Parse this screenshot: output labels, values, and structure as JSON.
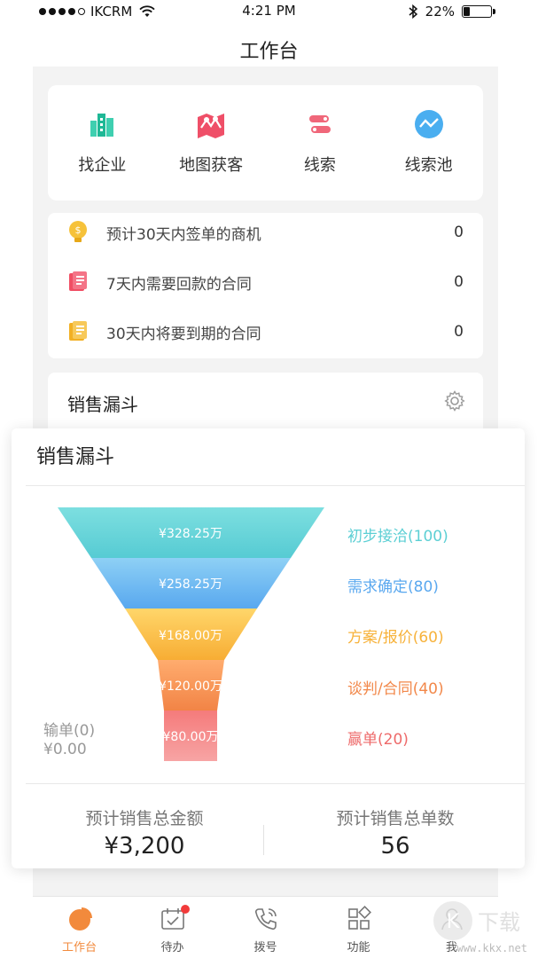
{
  "status_bar": {
    "carrier": "IKCRM",
    "time": "4:21 PM",
    "battery": "22%"
  },
  "header": {
    "title": "工作台"
  },
  "quick_entries": [
    {
      "label": "找企业",
      "icon": "building-icon"
    },
    {
      "label": "地图获客",
      "icon": "map-icon"
    },
    {
      "label": "线索",
      "icon": "route-icon"
    },
    {
      "label": "线索池",
      "icon": "trend-icon"
    }
  ],
  "stats": [
    {
      "label": "预计30天内签单的商机",
      "value": "0",
      "icon": "lightbulb-icon"
    },
    {
      "label": "7天内需要回款的合同",
      "value": "0",
      "icon": "receipt-icon"
    },
    {
      "label": "30天内将要到期的合同",
      "value": "0",
      "icon": "receipt-icon"
    }
  ],
  "funnel_card": {
    "title": "销售漏斗"
  },
  "popup": {
    "title": "销售漏斗",
    "stages": [
      {
        "amount": "¥328.25万",
        "label": "初步接洽(100)",
        "color": "#5ccfd4"
      },
      {
        "amount": "¥258.25万",
        "label": "需求确定(80)",
        "color": "#5aa8ef"
      },
      {
        "amount": "¥168.00万",
        "label": "方案/报价(60)",
        "color": "#f7b23b"
      },
      {
        "amount": "¥120.00万",
        "label": "谈判/合同(40)",
        "color": "#f2884a"
      },
      {
        "amount": "¥80.00万",
        "label": "赢单(20)",
        "color": "#ee6a6a"
      }
    ],
    "lost": {
      "label": "输单(0)",
      "amount": "¥0.00"
    },
    "summary": [
      {
        "label": "预计销售总金额",
        "value": "¥3,200"
      },
      {
        "label": "预计销售总单数",
        "value": "56"
      }
    ]
  },
  "tabs": [
    {
      "label": "工作台",
      "icon": "pie-chart-icon",
      "active": true
    },
    {
      "label": "待办",
      "icon": "calendar-check-icon",
      "badge": true
    },
    {
      "label": "拨号",
      "icon": "phone-icon"
    },
    {
      "label": "功能",
      "icon": "grid-icon"
    },
    {
      "label": "我",
      "icon": "person-icon"
    }
  ],
  "watermark": {
    "text": "www.kkx.net"
  }
}
